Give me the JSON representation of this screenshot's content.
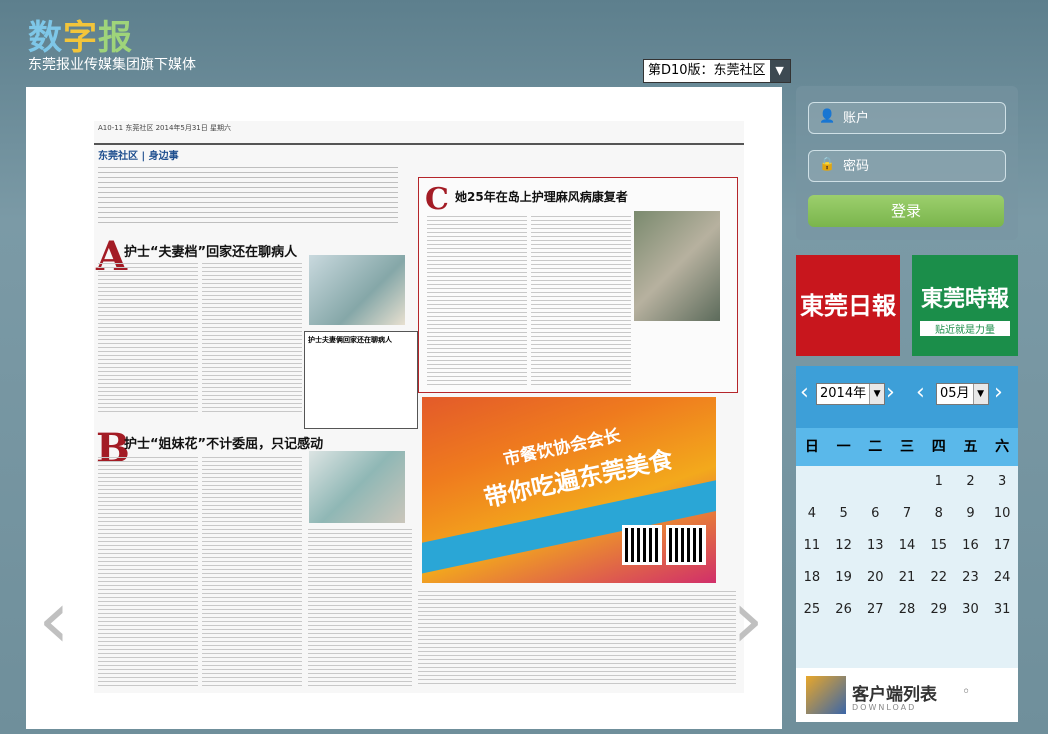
{
  "header": {
    "logo_part1": "数",
    "logo_part2": "字",
    "logo_part3": "报",
    "subtitle": "东莞报业传媒集团旗下媒体",
    "edition_selected": "第D10版：东莞社区"
  },
  "newspaper": {
    "page_header": "A10-11 东莞社区 2014年5月31日 星期六",
    "section": "东莞社区 | 身边事",
    "story_a_letter": "A",
    "story_a_title": "护士“夫妻档”回家还在聊病人",
    "story_b_letter": "B",
    "story_b_title": "护士“姐妹花”不计委屈，只记感动",
    "story_c_letter": "C",
    "story_c_title": "她25年在岛上护理麻风病康复者",
    "pullquote_title": "护士夫妻俩回家还在聊病人",
    "ad_line1": "市餐饮协会会长",
    "ad_line2": "带你吃遍东莞美食"
  },
  "login": {
    "username_placeholder": "账户",
    "password_placeholder": "密码",
    "login_label": "登录"
  },
  "partners": {
    "paper1": "東莞日報",
    "paper2": "東莞時報",
    "paper2_slogan": "贴近就是力量"
  },
  "calendar": {
    "year": "2014年",
    "month": "05月",
    "weekdays": [
      "日",
      "一",
      "二",
      "三",
      "四",
      "五",
      "六"
    ],
    "weeks": [
      [
        "",
        "",
        "",
        "",
        "1",
        "2",
        "3"
      ],
      [
        "4",
        "5",
        "6",
        "7",
        "8",
        "9",
        "10"
      ],
      [
        "11",
        "12",
        "13",
        "14",
        "15",
        "16",
        "17"
      ],
      [
        "18",
        "19",
        "20",
        "21",
        "22",
        "23",
        "24"
      ],
      [
        "25",
        "26",
        "27",
        "28",
        "29",
        "30",
        "31"
      ]
    ]
  },
  "download": {
    "title": "客户端列表",
    "subtitle": "DOWNLOAD"
  }
}
